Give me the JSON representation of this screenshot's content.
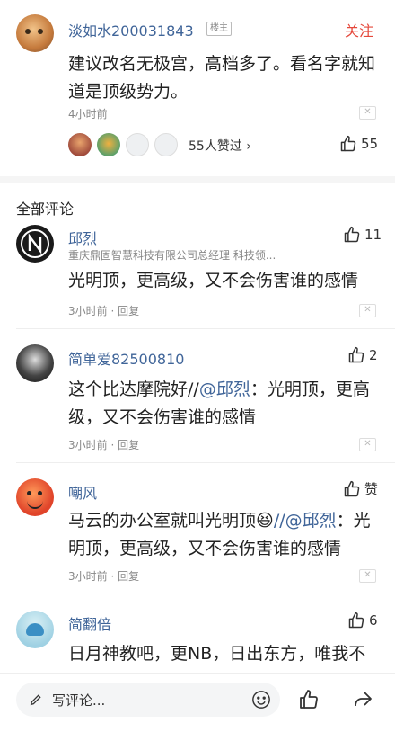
{
  "top_comment": {
    "username": "淡如水200031843",
    "badge": "楼主",
    "follow_label": "关注",
    "content": "建议改名无极宫，高档多了。看名字就知道是顶级势力。",
    "time": "4小时前",
    "likers_text": "55人赞过 ›",
    "like_count": "55"
  },
  "section_title": "全部评论",
  "comments": [
    {
      "username": "邱烈",
      "subtitle": "重庆鼎固智慧科技有限公司总经理 科技领...",
      "like_count": "11",
      "content": "光明顶，更高级，又不会伤害谁的感情",
      "meta": "3小时前 · 回复"
    },
    {
      "username": "简单爱82500810",
      "like_count": "2",
      "content_prefix": "这个比达摩院好//",
      "mention": "@邱烈",
      "content_suffix": "：光明顶，更高级，又不会伤害谁的感情",
      "meta": "3小时前 · 回复"
    },
    {
      "username": "嘲风",
      "like_count": "赞",
      "content_prefix": "马云的办公室就叫光明顶",
      "emoji": "😆",
      "mention": "//@邱烈",
      "content_suffix": "：光明顶，更高级，又不会伤害谁的感情",
      "meta": "3小时前 · 回复"
    },
    {
      "username": "简翻倍",
      "like_count": "6",
      "content": "日月神教吧，更NB，日出东方，唯我不败，广告语都是现成的"
    }
  ],
  "bottom_bar": {
    "comment_placeholder": "写评论..."
  },
  "colors": {
    "name_blue": "#406599",
    "follow_red": "#e5483b",
    "meta_gray": "#888888"
  }
}
